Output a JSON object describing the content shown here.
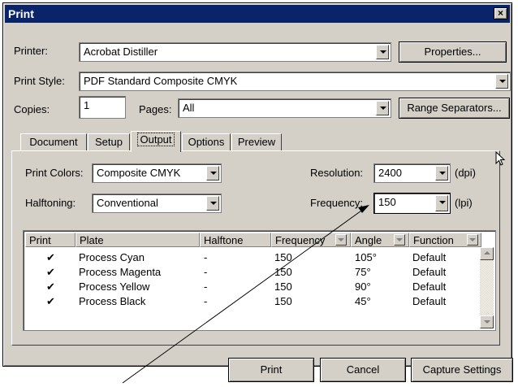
{
  "window": {
    "title": "Print",
    "close_glyph": "×"
  },
  "printer": {
    "label": "Printer:",
    "value": "Acrobat Distiller",
    "properties_button": "Properties..."
  },
  "print_style": {
    "label": "Print Style:",
    "value": "PDF Standard Composite CMYK"
  },
  "copies": {
    "label": "Copies:",
    "value": "1"
  },
  "pages": {
    "label": "Pages:",
    "value": "All",
    "range_button": "Range Separators..."
  },
  "tabs": [
    {
      "label": "Document"
    },
    {
      "label": "Setup"
    },
    {
      "label": "Output",
      "active": true
    },
    {
      "label": "Options"
    },
    {
      "label": "Preview"
    }
  ],
  "output": {
    "print_colors": {
      "label": "Print Colors:",
      "value": "Composite CMYK"
    },
    "halftoning": {
      "label": "Halftoning:",
      "value": "Conventional"
    },
    "resolution": {
      "label": "Resolution:",
      "value": "2400",
      "unit": "(dpi)"
    },
    "frequency": {
      "label": "Frequency:",
      "value": "150",
      "unit": "(lpi)"
    }
  },
  "plates_table": {
    "columns": [
      "Print",
      "Plate",
      "Halftone",
      "Frequency",
      "Angle",
      "Function"
    ],
    "rows": [
      {
        "print": "✔",
        "plate": "Process Cyan",
        "halftone": "-",
        "frequency": "150",
        "angle": "105°",
        "function": "Default"
      },
      {
        "print": "✔",
        "plate": "Process Magenta",
        "halftone": "-",
        "frequency": "150",
        "angle": "75°",
        "function": "Default"
      },
      {
        "print": "✔",
        "plate": "Process Yellow",
        "halftone": "-",
        "frequency": "150",
        "angle": "90°",
        "function": "Default"
      },
      {
        "print": "✔",
        "plate": "Process Black",
        "halftone": "-",
        "frequency": "150",
        "angle": "45°",
        "function": "Default"
      }
    ]
  },
  "footer": {
    "print_button": "Print",
    "cancel_button": "Cancel",
    "capture_button": "Capture Settings"
  },
  "colors": {
    "title_bar": "#0a246a",
    "face": "#d4d0c8"
  }
}
